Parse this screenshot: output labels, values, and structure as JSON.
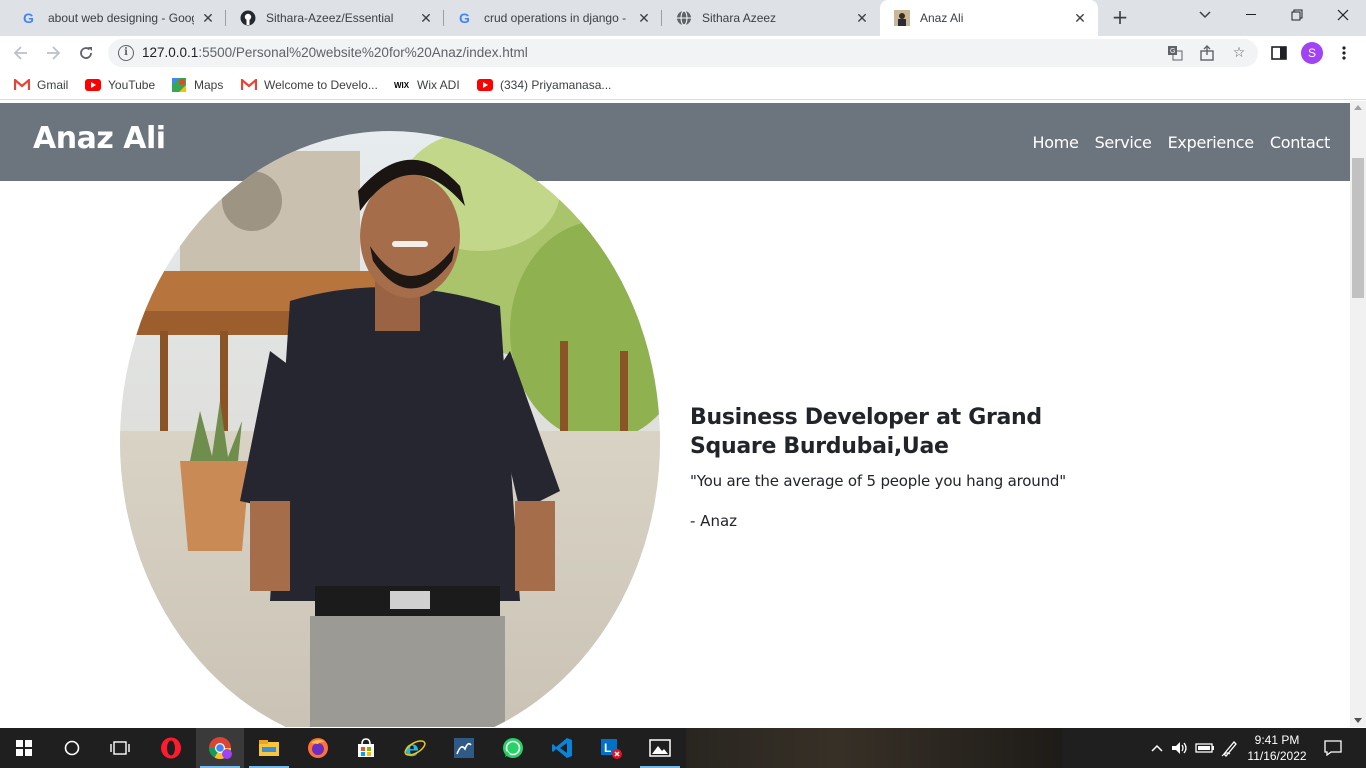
{
  "browser": {
    "tabs": [
      {
        "title": "about web designing - Goog",
        "icon": "google-icon",
        "active": false
      },
      {
        "title": "Sithara-Azeez/Essential",
        "icon": "github-icon",
        "active": false
      },
      {
        "title": "crud operations in django - G",
        "icon": "google-icon",
        "active": false
      },
      {
        "title": "Sithara Azeez",
        "icon": "globe-icon",
        "active": false
      },
      {
        "title": "Anaz Ali",
        "icon": "profile-photo-icon",
        "active": true
      }
    ],
    "url_host": "127.0.0.1",
    "url_path": ":5500/Personal%20website%20for%20Anaz/index.html",
    "profile_initial": "S",
    "bookmarks": [
      {
        "label": "Gmail",
        "icon": "gmail-icon"
      },
      {
        "label": "YouTube",
        "icon": "youtube-icon"
      },
      {
        "label": "Maps",
        "icon": "maps-icon"
      },
      {
        "label": "Welcome to Develo...",
        "icon": "gmail-icon"
      },
      {
        "label": "Wix ADI",
        "icon": "wix-icon"
      },
      {
        "label": "(334) Priyamanasa...",
        "icon": "youtube-icon"
      }
    ]
  },
  "site": {
    "brand": "Anaz Ali",
    "nav": [
      "Home",
      "Service",
      "Experience",
      "Contact"
    ],
    "hero": {
      "title": "Business Developer at Grand Square Burdubai,Uae",
      "quote": "\"You are the average of 5 people you hang around\"",
      "author": "- Anaz"
    }
  },
  "taskbar": {
    "time": "9:41 PM",
    "date": "11/16/2022",
    "apps": [
      "windows-start-icon",
      "search-circle-icon",
      "task-view-icon",
      "opera-icon",
      "chrome-icon",
      "file-explorer-icon",
      "firefox-icon",
      "microsoft-store-icon",
      "internet-explorer-icon",
      "mysql-workbench-icon",
      "whatsapp-icon",
      "vscode-icon",
      "lync-icon",
      "photos-icon"
    ]
  },
  "colors": {
    "nav_bg": "#6c757d",
    "text": "#212529",
    "tab_strip": "#dee1e6",
    "taskbar": "#1f1f1f"
  }
}
